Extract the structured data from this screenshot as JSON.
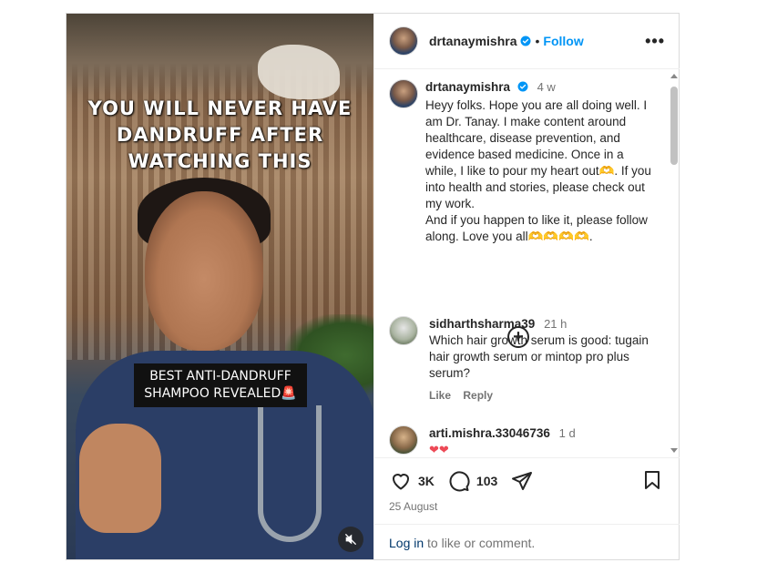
{
  "media": {
    "overlay_title_lines": [
      "YOU WILL NEVER HAVE",
      "DANDRUFF AFTER",
      "WATCHING THIS"
    ],
    "caption_box": "BEST ANTI-DANDRUFF SHAMPOO REVEALED🚨",
    "mute_icon": "muted-speaker-icon"
  },
  "header": {
    "username": "drtanaymishra",
    "separator": "•",
    "follow_label": "Follow",
    "more_icon": "•••"
  },
  "caption": {
    "username": "drtanaymishra",
    "time": "4 w",
    "text": "Heyy folks. Hope you are all doing well. I am Dr. Tanay. I make content around healthcare, disease prevention, and evidence based medicine. Once in a while, I like to pour my heart out🫶. If you into health and stories, please check out my work.\nAnd if you happen to like it, please follow along. Love you all🫶🫶🫶🫶."
  },
  "load_more_icon": "+",
  "comments": [
    {
      "username": "sidharthsharma39",
      "time": "21 h",
      "text": "Which hair growth serum is good: tugain hair growth serum or mintop pro plus serum?",
      "like_label": "Like",
      "reply_label": "Reply"
    },
    {
      "username": "arti.mishra.33046736",
      "time": "1 d",
      "text": "❤❤"
    }
  ],
  "actions": {
    "likes": "3K",
    "comments": "103",
    "date": "25 August"
  },
  "login": {
    "link": "Log in",
    "rest": " to like or comment."
  },
  "colors": {
    "accent": "#0095f6",
    "text": "#262626",
    "muted": "#737373",
    "heart": "#ed4956"
  }
}
